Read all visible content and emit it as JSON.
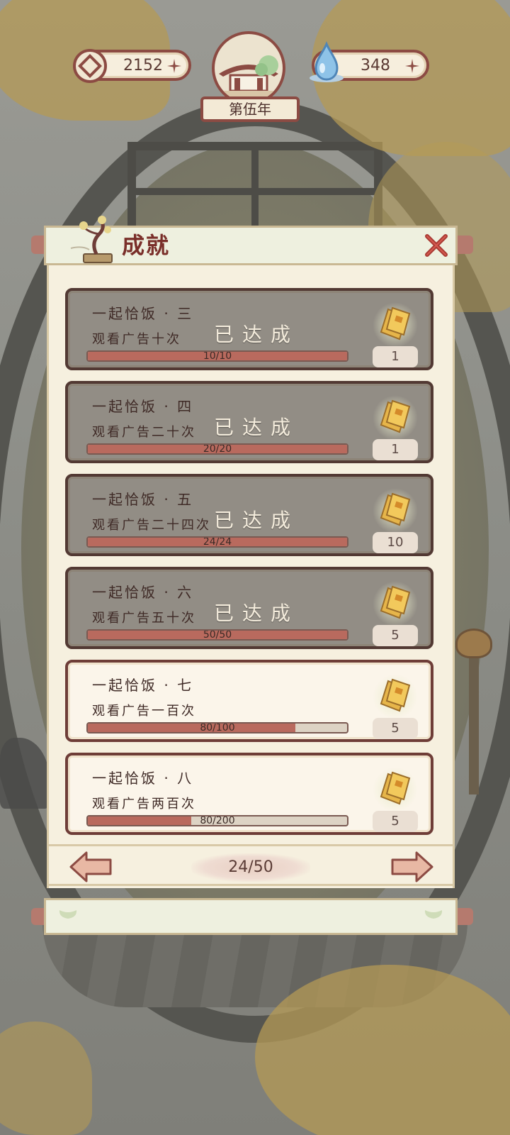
{
  "resources": {
    "coins": "2152",
    "water": "348"
  },
  "year": {
    "label": "第伍年"
  },
  "panel": {
    "title": "成就",
    "done_label": "已达成"
  },
  "achievements": [
    {
      "title": "一起恰饭 · 三",
      "desc": "观看广告十次",
      "progress_text": "10/10",
      "progress": 1.0,
      "reward": "1",
      "completed": true
    },
    {
      "title": "一起恰饭 · 四",
      "desc": "观看广告二十次",
      "progress_text": "20/20",
      "progress": 1.0,
      "reward": "1",
      "completed": true
    },
    {
      "title": "一起恰饭 · 五",
      "desc": "观看广告二十四次",
      "progress_text": "24/24",
      "progress": 1.0,
      "reward": "10",
      "completed": true
    },
    {
      "title": "一起恰饭 · 六",
      "desc": "观看广告五十次",
      "progress_text": "50/50",
      "progress": 1.0,
      "reward": "5",
      "completed": true
    },
    {
      "title": "一起恰饭 · 七",
      "desc": "观看广告一百次",
      "progress_text": "80/100",
      "progress": 0.8,
      "reward": "5",
      "completed": false
    },
    {
      "title": "一起恰饭 · 八",
      "desc": "观看广告两百次",
      "progress_text": "80/200",
      "progress": 0.4,
      "reward": "5",
      "completed": false
    }
  ],
  "pagination": {
    "count": "24/50"
  },
  "colors": {
    "accent": "#8c4b43",
    "progress_fill": "#b96a5e",
    "panel_bg": "#f6f0df"
  }
}
